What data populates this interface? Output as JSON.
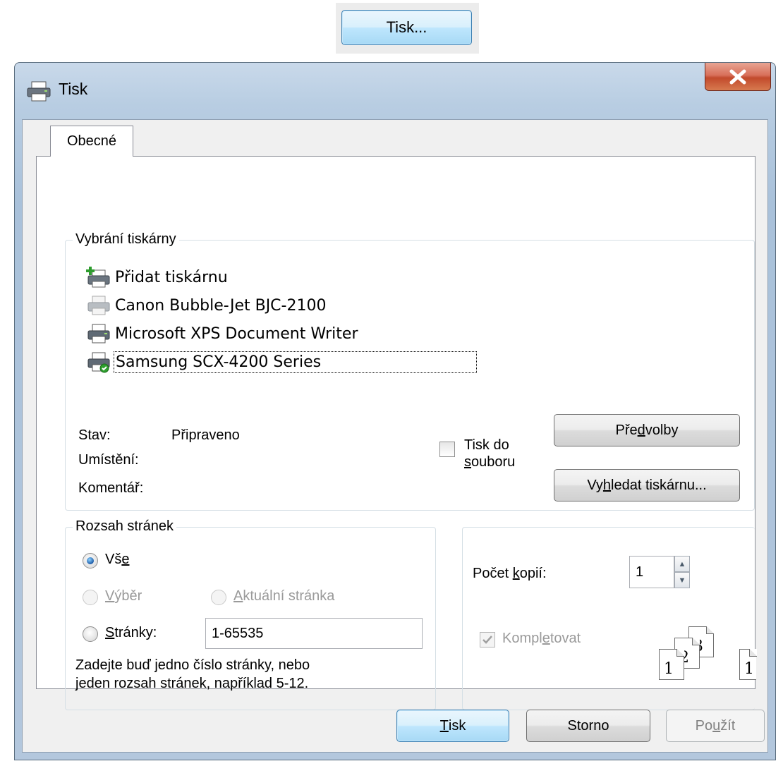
{
  "trigger": {
    "label": "Tisk..."
  },
  "window": {
    "title": "Tisk",
    "close_label": "X"
  },
  "tabs": [
    {
      "label": "Obecné"
    }
  ],
  "printer_group": {
    "label": "Vybrání tiskárny",
    "printers": [
      {
        "name": "Přidat tiskárnu",
        "icon": "add-printer-icon"
      },
      {
        "name": "Canon Bubble-Jet BJC-2100",
        "icon": "printer-offline-icon"
      },
      {
        "name": "Microsoft XPS Document Writer",
        "icon": "printer-icon"
      },
      {
        "name": "Samsung SCX-4200 Series",
        "icon": "default-printer-icon"
      }
    ],
    "selected_index": 3,
    "status_label": "Stav:",
    "status_value": "Připraveno",
    "location_label": "Umístění:",
    "comment_label": "Komentář:",
    "print_to_file_line1": "Tisk do",
    "print_to_file_line2_rest": "ouboru",
    "print_to_file_line2_mnemonic": "s",
    "print_to_file_checked": false,
    "preferences_before": "Pře",
    "preferences_mnemonic": "d",
    "preferences_after": "volby",
    "find_printer_before": "Vy",
    "find_printer_mnemonic": "h",
    "find_printer_after": "ledat tiskárnu..."
  },
  "page_range": {
    "label": "Rozsah stránek",
    "all_before": "Vš",
    "all_mnemonic": "e",
    "selection_mnemonic": "V",
    "selection_after": "ýběr",
    "current_mnemonic": "A",
    "current_after": "ktuální stránka",
    "pages_mnemonic": "S",
    "pages_after": "tránky:",
    "pages_value": "1-65535",
    "hint_line1": "Zadejte buď jedno číslo stránky, nebo",
    "hint_line2": "jeden rozsah stránek, například 5-12.",
    "selected": "all"
  },
  "copies": {
    "label_before": "Počet ",
    "label_mnemonic": "k",
    "label_after": "opií:",
    "value": "1",
    "collate_before": "Kompl",
    "collate_mnemonic": "e",
    "collate_after": "tovat",
    "collate_checked": true,
    "collate_enabled": false,
    "collate_pages": [
      "1",
      "2",
      "3"
    ],
    "collate_pages_second": [
      "1"
    ]
  },
  "footer": {
    "print_mnemonic": "T",
    "print_after": "isk",
    "cancel_label": "Storno",
    "apply_before": "Po",
    "apply_mnemonic": "u",
    "apply_after": "žít"
  },
  "colors": {
    "title_bar": "#b8cde2",
    "close_button": "#c24a2c",
    "focus_button": "#a7d9f5",
    "dialog_bg": "#f0f0f0"
  }
}
